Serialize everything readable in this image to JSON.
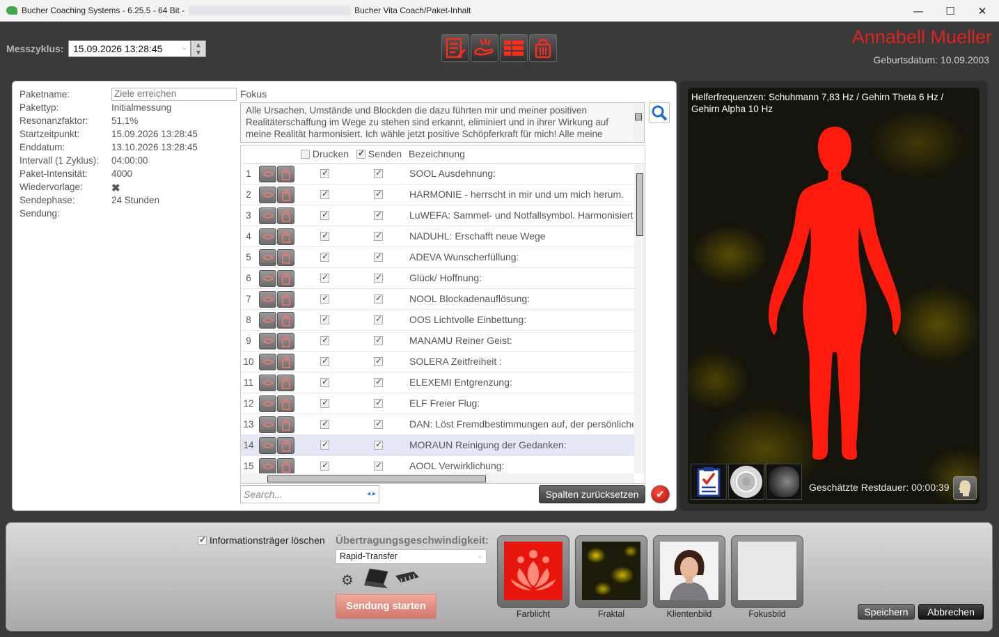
{
  "window": {
    "title_left": "Bucher Coaching Systems - 6.25.5 - 64 Bit -",
    "title_right": "Bucher Vita Coach/Paket-Inhalt",
    "minimize": "—",
    "maximize": "☐",
    "close": "✕"
  },
  "header": {
    "messzyklus_label": "Messzyklus:",
    "messzyklus_value": "15.09.2026 13:28:45",
    "client_name": "Annabell Mueller",
    "birth_date": "Geburtsdatum: 10.09.2003"
  },
  "info": {
    "paketname_label": "Paketname:",
    "paketname_value": "Ziele erreichen",
    "pakettyp_label": "Pakettyp:",
    "pakettyp_value": "Initialmessung",
    "resonanz_label": "Resonanzfaktor:",
    "resonanz_value": "51,1%",
    "start_label": "Startzeitpunkt:",
    "start_value": "15.09.2026 13:28:45",
    "end_label": "Enddatum:",
    "end_value": "13.10.2026 13:28:45",
    "intervall_label": "Intervall (1 Zyklus):",
    "intervall_value": "04:00:00",
    "intens_label": "Paket-Intensität:",
    "intens_value": "4000",
    "wieder_label": "Wiedervorlage:",
    "wieder_value": "✖",
    "sende_label": "Sendephase:",
    "sende_value": "24 Stunden",
    "sendung_label": "Sendung:"
  },
  "fokus": {
    "label": "Fokus",
    "text": "Alle Ursachen, Umstände und Blockden die dazu führten mir und meiner positiven Realitäterschaffung  im Wege zu stehen sind erkannt, eliminiert und in ihrer Wirkung auf meine Realität harmonisiert. Ich wähle jetzt positive Schöpferkraft für mich! Alle meine"
  },
  "table": {
    "col_drucken": "Drucken",
    "col_senden": "Senden",
    "col_bezeichnung": "Bezeichnung",
    "rows": [
      {
        "num": "1",
        "desc": "SOOL Ausdehnung:"
      },
      {
        "num": "2",
        "desc": "HARMONIE - herrscht in mir und um mich herum."
      },
      {
        "num": "3",
        "desc": "LuWEFA: Sammel- und Notfallsymbol. Harmonisiert"
      },
      {
        "num": "4",
        "desc": "NADUHL:  Erschafft neue Wege"
      },
      {
        "num": "5",
        "desc": "ADEVA Wunscherfüllung:"
      },
      {
        "num": "6",
        "desc": "Glück/ Hoffnung:"
      },
      {
        "num": "7",
        "desc": "NOOL Blockadenauflösung:"
      },
      {
        "num": "8",
        "desc": "OOS Lichtvolle Einbettung:"
      },
      {
        "num": "9",
        "desc": "MANAMU Reiner Geist:"
      },
      {
        "num": "10",
        "desc": "SOLERA Zeitfreiheit :"
      },
      {
        "num": "11",
        "desc": "ELEXEMI Entgrenzung:"
      },
      {
        "num": "12",
        "desc": "ELF Freier Flug:"
      },
      {
        "num": "13",
        "desc": "DAN: Löst Fremdbestimmungen auf, der persönliche"
      },
      {
        "num": "14",
        "desc": "MORAUN Reinigung der Gedanken:"
      },
      {
        "num": "15",
        "desc": "AOOL Verwirklichung:"
      }
    ]
  },
  "search": {
    "placeholder": "Search...",
    "arrows": "◂ ▸"
  },
  "buttons": {
    "reset": "Spalten zurücksetzen",
    "ok": "✔",
    "start": "Sendung starten",
    "save": "Speichern",
    "cancel": "Abbrechen"
  },
  "image_panel": {
    "helper_text": "Helferfrequenzen: Schuhmann 7,83 Hz / Gehirn Theta 6 Hz / Gehirn Alpha 10 Hz",
    "rest_text": "Geschätzte Restdauer: 00:00:39"
  },
  "bottom": {
    "info_loeschen": "Informationsträger löschen",
    "speed_label": "Übertragungsgeschwindigkeit:",
    "speed_value": "Rapid-Transfer",
    "slots": [
      "Farblicht",
      "Fraktal",
      "Klientenbild",
      "Fokusbild"
    ]
  },
  "colors": {
    "accent_red": "#e0231a",
    "body_red": "#ff1a0e",
    "dark_bg": "#3a3a3a"
  }
}
